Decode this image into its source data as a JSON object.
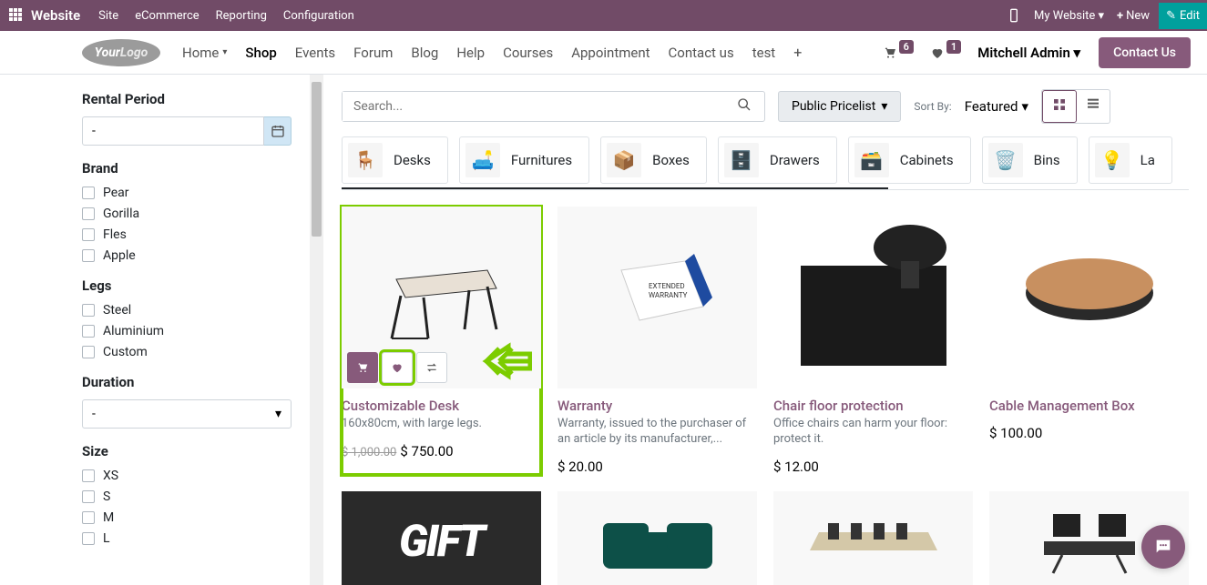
{
  "topbar": {
    "brand": "Website",
    "menu": [
      "Site",
      "eCommerce",
      "Reporting",
      "Configuration"
    ],
    "mywebsite": "My Website",
    "new": "New",
    "edit": "Edit"
  },
  "header": {
    "logo1": "Your",
    "logo2": "Logo",
    "nav": [
      "Home",
      "Shop",
      "Events",
      "Forum",
      "Blog",
      "Help",
      "Courses",
      "Appointment",
      "Contact us",
      "test"
    ],
    "cart_count": "6",
    "wishlist_count": "1",
    "user": "Mitchell Admin",
    "contact": "Contact Us"
  },
  "sidebar": {
    "rental_title": "Rental Period",
    "rental_value": "-",
    "brand_title": "Brand",
    "brands": [
      "Pear",
      "Gorilla",
      "Fles",
      "Apple"
    ],
    "legs_title": "Legs",
    "legs": [
      "Steel",
      "Aluminium",
      "Custom"
    ],
    "duration_title": "Duration",
    "duration_value": "-",
    "size_title": "Size",
    "sizes": [
      "XS",
      "S",
      "M",
      "L"
    ]
  },
  "toolbar": {
    "search_placeholder": "Search...",
    "pricelist": "Public Pricelist",
    "sortby_label": "Sort By:",
    "sort_value": "Featured"
  },
  "categories": [
    {
      "label": "Desks",
      "icon": "🪑"
    },
    {
      "label": "Furnitures",
      "icon": "🛋️"
    },
    {
      "label": "Boxes",
      "icon": "📦"
    },
    {
      "label": "Drawers",
      "icon": "🗄️"
    },
    {
      "label": "Cabinets",
      "icon": "🗃️"
    },
    {
      "label": "Bins",
      "icon": "🗑️"
    },
    {
      "label": "La",
      "icon": "💡"
    }
  ],
  "products": [
    {
      "title": "Customizable Desk",
      "desc": "160x80cm, with large legs.",
      "old_price": "$ 1,000.00",
      "price": "$ 750.00"
    },
    {
      "title": "Warranty",
      "desc": "Warranty, issued to the purchaser of an article by its manufacturer,...",
      "price": "$ 20.00"
    },
    {
      "title": "Chair floor protection",
      "desc": "Office chairs can harm your floor: protect it.",
      "price": "$ 12.00"
    },
    {
      "title": "Cable Management Box",
      "desc": "",
      "price": "$ 100.00"
    }
  ]
}
